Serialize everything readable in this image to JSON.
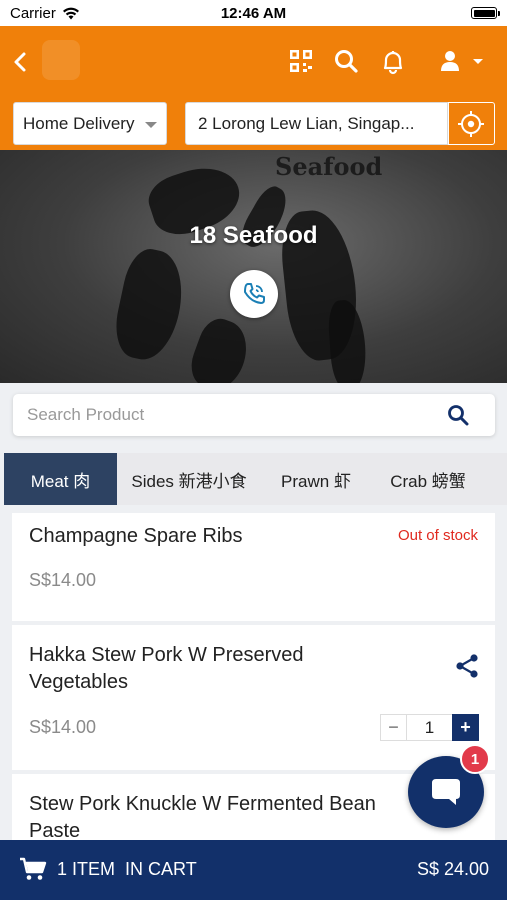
{
  "status_bar": {
    "carrier": "Carrier",
    "time": "12:46 AM"
  },
  "header": {
    "delivery_mode": "Home Delivery",
    "address": "2 Lorong Lew Lian, Singap...",
    "brand_color": "#f0800a"
  },
  "banner": {
    "watermark_text": "Seafood",
    "restaurant_name": "18 Seafood"
  },
  "search": {
    "placeholder": "Search Product"
  },
  "tabs": [
    {
      "label": "Meat 肉",
      "active": true
    },
    {
      "label": "Sides 新港小食",
      "active": false
    },
    {
      "label": "Prawn 虾",
      "active": false
    },
    {
      "label": "Crab 螃蟹",
      "active": false
    }
  ],
  "products": [
    {
      "name": "Champagne Spare Ribs",
      "price": "S$14.00",
      "status": "Out of stock"
    },
    {
      "name_line1": "Hakka Stew Pork W Preserved",
      "name_line2": "Vegetables",
      "price": "S$14.00",
      "quantity": "1"
    },
    {
      "name_line1": "Stew Pork Knuckle W Fermented Bean",
      "name_line2": "Paste"
    }
  ],
  "chat": {
    "badge_count": "1"
  },
  "cart": {
    "summary": "1 ITEM  IN CART",
    "total": "S$ 24.00"
  },
  "colors": {
    "navy": "#12306a",
    "active_tab": "#2d4262",
    "out_of_stock": "#e0291f"
  },
  "icons": [
    "back-icon",
    "qr-code-icon",
    "search-icon",
    "bell-icon",
    "user-icon",
    "caret-down-icon",
    "locate-icon",
    "phone-icon",
    "share-icon",
    "chat-icon",
    "cart-icon"
  ]
}
